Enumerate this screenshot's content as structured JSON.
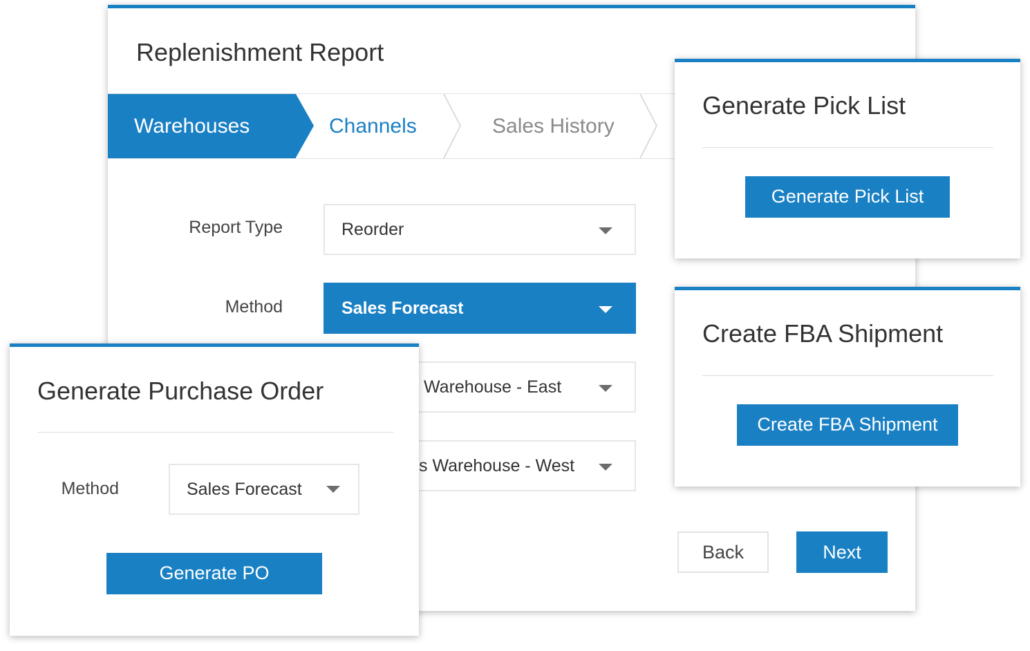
{
  "report": {
    "title": "Replenishment Report",
    "steps": [
      "Warehouses",
      "Channels",
      "Sales History"
    ],
    "fields": {
      "report_type": {
        "label": "Report Type",
        "value": "Reorder"
      },
      "method": {
        "label": "Method",
        "value": "Sales Forecast"
      },
      "warehouse_1": {
        "value": "Warehouse - East"
      },
      "warehouse_2": {
        "value": "s Warehouse - West"
      }
    },
    "back_label": "Back",
    "next_label": "Next"
  },
  "pick_list": {
    "title": "Generate Pick List",
    "button_label": "Generate Pick List"
  },
  "fba": {
    "title": "Create FBA Shipment",
    "button_label": "Create FBA Shipment"
  },
  "purchase_order": {
    "title": "Generate Purchase Order",
    "method_label": "Method",
    "method_value": "Sales Forecast",
    "button_label": "Generate PO"
  },
  "colors": {
    "accent": "#1a80c4"
  }
}
